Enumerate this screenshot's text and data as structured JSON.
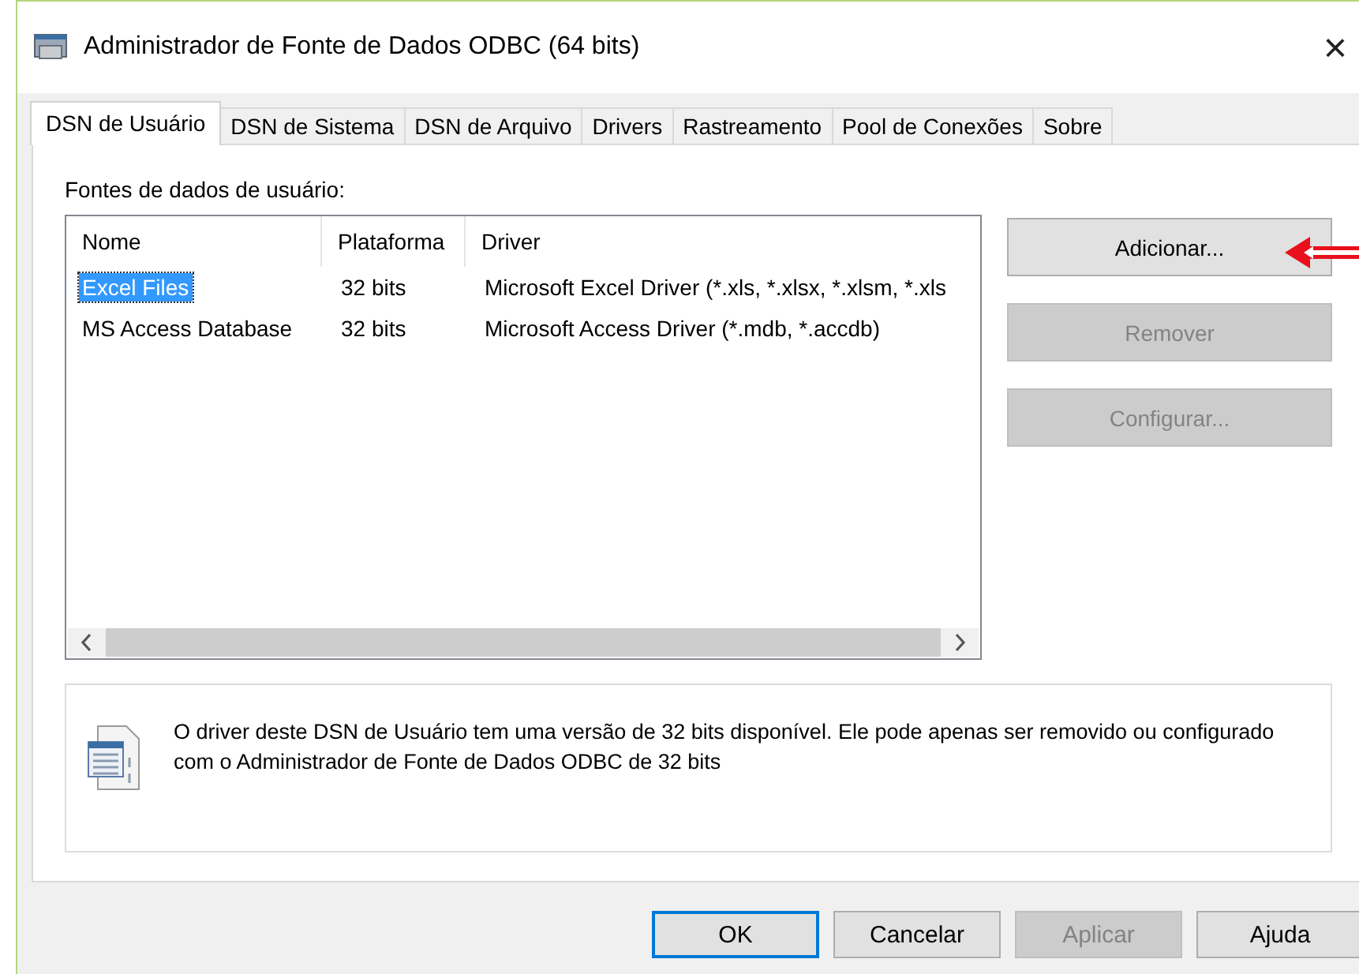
{
  "window": {
    "title": "Administrador de Fonte de Dados ODBC (64 bits)",
    "close": "×"
  },
  "tabs": [
    {
      "label": "DSN de Usuário",
      "selected": true
    },
    {
      "label": "DSN de Sistema",
      "selected": false
    },
    {
      "label": "DSN de Arquivo",
      "selected": false
    },
    {
      "label": "Drivers",
      "selected": false
    },
    {
      "label": "Rastreamento",
      "selected": false
    },
    {
      "label": "Pool de Conexões",
      "selected": false
    },
    {
      "label": "Sobre",
      "selected": false
    }
  ],
  "list_label": "Fontes de dados de usuário:",
  "table": {
    "columns": [
      "Nome",
      "Plataforma",
      "Driver"
    ],
    "rows": [
      {
        "cells": [
          "Excel Files",
          "32 bits",
          "Microsoft Excel Driver (*.xls, *.xlsx, *.xlsm, *.xls"
        ],
        "selected": true
      },
      {
        "cells": [
          "MS Access Database",
          "32 bits",
          "Microsoft Access Driver (*.mdb, *.accdb)"
        ],
        "selected": false
      }
    ]
  },
  "side_buttons": [
    {
      "label": "Adicionar...",
      "disabled": false
    },
    {
      "label": "Remover",
      "disabled": true
    },
    {
      "label": "Configurar...",
      "disabled": true
    }
  ],
  "info": "O driver deste DSN de Usuário tem uma versão de 32 bits disponível. Ele pode apenas ser removido ou configurado com o Administrador de Fonte de Dados ODBC de 32 bits",
  "buttons": [
    {
      "label": "OK",
      "disabled": false,
      "default": true
    },
    {
      "label": "Cancelar",
      "disabled": false,
      "default": false
    },
    {
      "label": "Aplicar",
      "disabled": true,
      "default": false
    },
    {
      "label": "Ajuda",
      "disabled": false,
      "default": false
    }
  ]
}
